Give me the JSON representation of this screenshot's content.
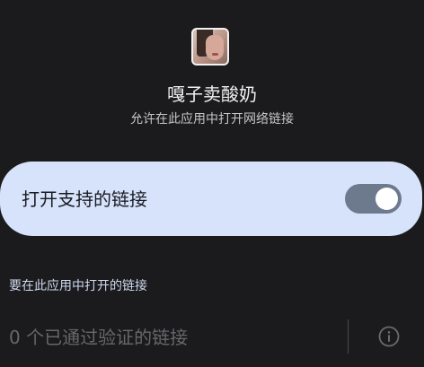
{
  "app": {
    "name": "嘎子卖酸奶",
    "subtitle": "允许在此应用中打开网络链接"
  },
  "toggle": {
    "label": "打开支持的链接",
    "enabled": true
  },
  "section": {
    "header": "要在此应用中打开的链接"
  },
  "verified_links": {
    "text": "0 个已通过验证的链接",
    "icon": "info-icon"
  },
  "colors": {
    "background": "#1b1b1d",
    "card": "#d6e3fb",
    "switch_track": "#6d7a8d",
    "section_header": "#cfd8ee"
  }
}
